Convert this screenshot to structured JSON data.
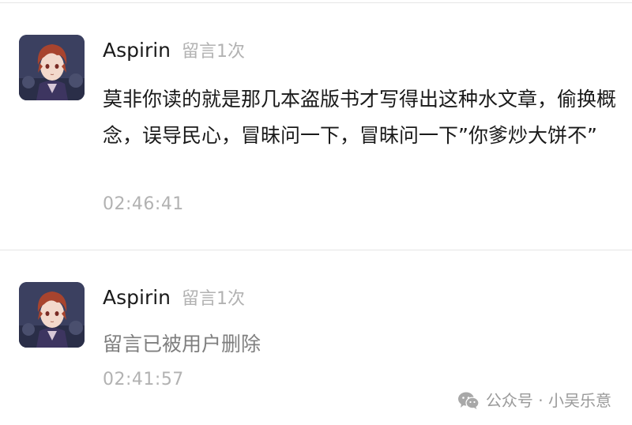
{
  "comments": [
    {
      "username": "Aspirin",
      "message_count": "留言1次",
      "content": "莫非你读的就是那几本盗版书才写得出这种水文章，偷换概念，误导民心，冒昧问一下，冒昧问一下”你爹炒大饼不”",
      "time": "02:46:41",
      "avatar_icon": "anime-boy-avatar"
    },
    {
      "username": "Aspirin",
      "message_count": "留言1次",
      "content": "留言已被用户删除",
      "time": "02:41:57",
      "avatar_icon": "anime-boy-avatar"
    }
  ],
  "watermark": {
    "text": "公众号 · 小吴乐意",
    "icon": "wechat-icon"
  },
  "colors": {
    "username": "#1a1a1a",
    "meta": "#b2b2b2",
    "deleted_text": "#7f7f7f",
    "divider": "#e5e5e5"
  }
}
